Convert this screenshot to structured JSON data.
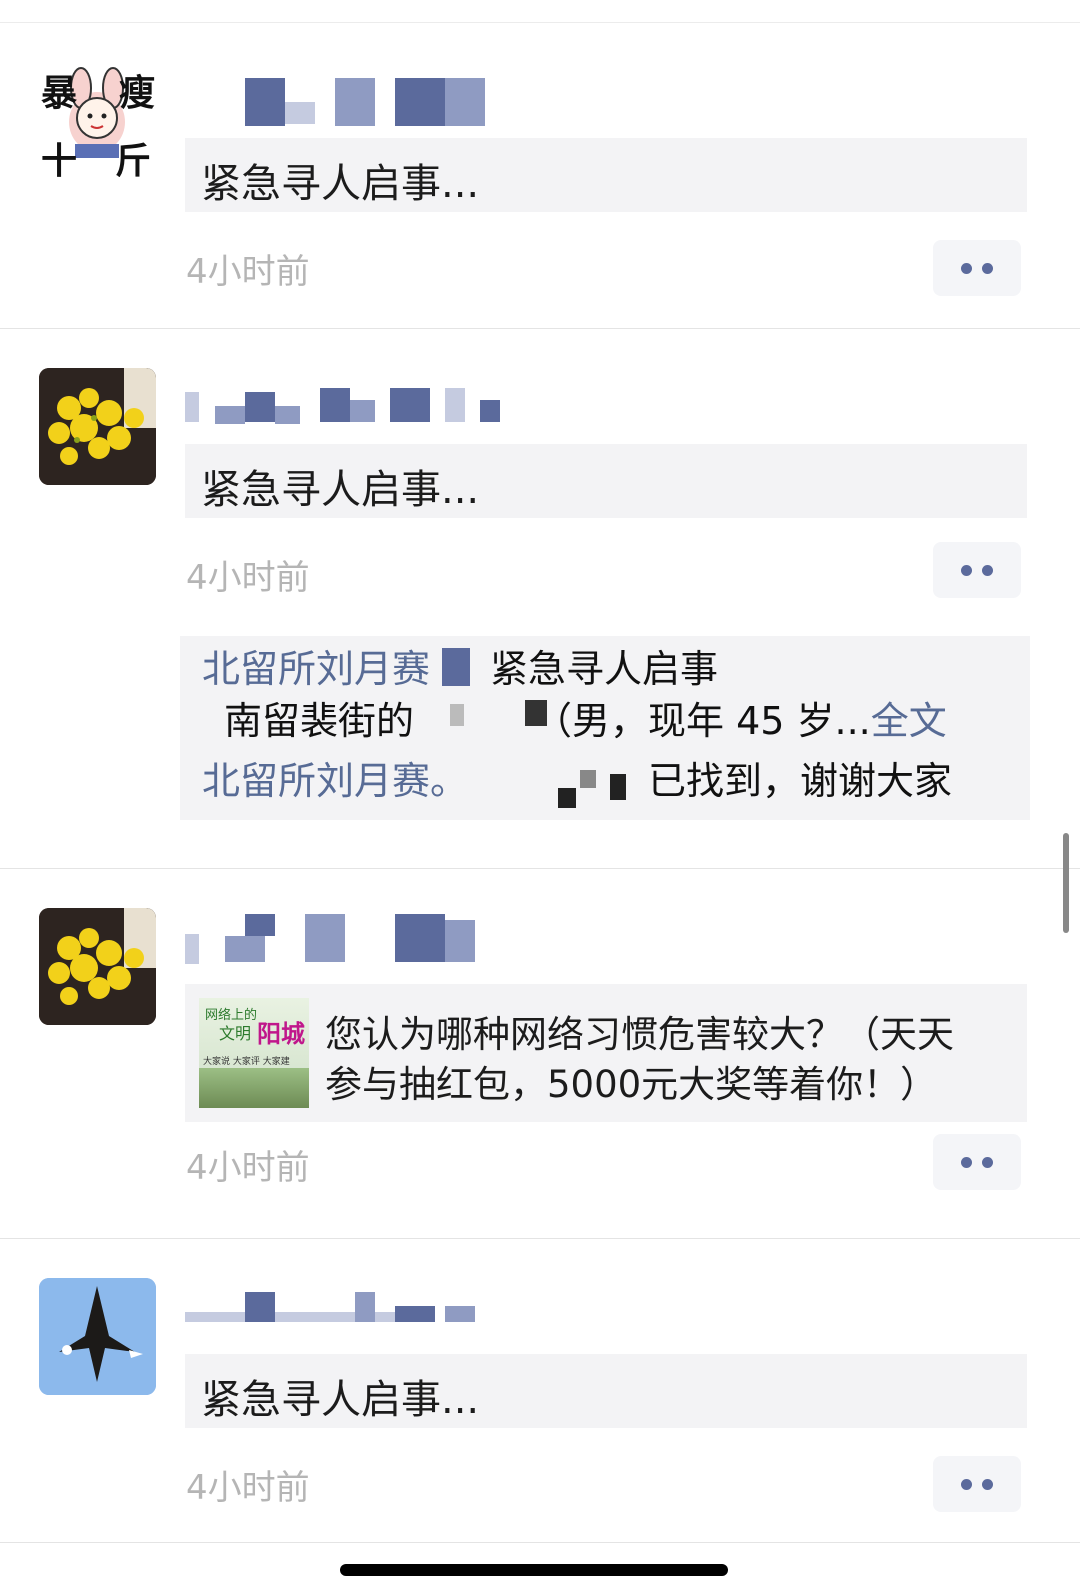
{
  "posts": [
    {
      "avatar": "cartoon-girl-sticker",
      "avatar_text": [
        "暴",
        "瘦",
        "十",
        "斤"
      ],
      "share_text": "紧急寻人启事...",
      "time": "4小时前"
    },
    {
      "avatar": "yellow-flowers",
      "share_text": "紧急寻人启事...",
      "time": "4小时前",
      "comments": [
        {
          "name": "北留所刘月赛",
          "text": "紧急寻人启事"
        },
        {
          "text": "南留裴街的",
          "text2": "（男，现年 45 岁...",
          "more": "全文"
        },
        {
          "name": "北留所刘月赛。",
          "text": "已找到，谢谢大家"
        }
      ]
    },
    {
      "avatar": "yellow-flowers",
      "thumb_text": [
        "网络上的",
        "文明",
        "阳城",
        "大家说 大家评 大家建"
      ],
      "share_text_1": "您认为哪种网络习惯危害较大？（天天",
      "share_text_2": "参与抽红包，5000元大奖等着你！）",
      "time": "4小时前"
    },
    {
      "avatar": "eagle",
      "share_text": "紧急寻人启事...",
      "time": "4小时前"
    }
  ],
  "colors": {
    "link": "#576b95",
    "time": "#b5b5b5",
    "card_bg": "#f3f3f5"
  }
}
